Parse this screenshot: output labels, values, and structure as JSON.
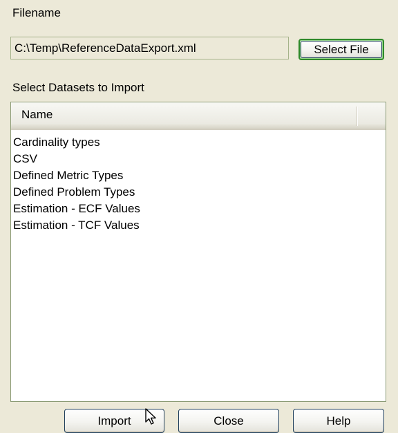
{
  "filename": {
    "label": "Filename",
    "value": "C:\\Temp\\ReferenceDataExport.xml",
    "select_button_label": "Select File"
  },
  "datasets": {
    "label": "Select Datasets to Import",
    "column_header": "Name",
    "items": [
      "Cardinality types",
      "CSV",
      "Defined Metric Types",
      "Defined Problem Types",
      "Estimation - ECF Values",
      "Estimation - TCF Values"
    ]
  },
  "buttons": {
    "import": "Import",
    "close": "Close",
    "help": "Help"
  },
  "cursor_icon": "arrow-pointer-icon"
}
